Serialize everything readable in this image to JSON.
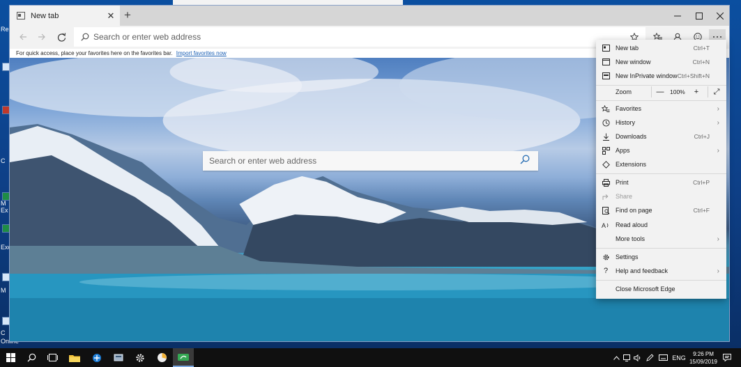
{
  "desktop": {
    "labels": [
      "Re",
      "C",
      "M",
      "Ex",
      "Exc",
      "M",
      "C",
      "Online"
    ]
  },
  "browser": {
    "tab_title": "New tab",
    "tab_close": "✕",
    "new_tab": "+",
    "address_placeholder": "Search or enter web address",
    "favorites_bar_text": "For quick access, place your favorites here on the favorites bar.",
    "favorites_bar_link": "Import favorites now",
    "page_search_placeholder": "Search or enter web address"
  },
  "menu": {
    "new_tab": {
      "label": "New tab",
      "shortcut": "Ctrl+T"
    },
    "new_window": {
      "label": "New window",
      "shortcut": "Ctrl+N"
    },
    "new_inprivate": {
      "label": "New InPrivate window",
      "shortcut": "Ctrl+Shift+N"
    },
    "zoom": {
      "label": "Zoom",
      "minus": "—",
      "value": "100%",
      "plus": "+",
      "fullscreen": "⤢"
    },
    "favorites": {
      "label": "Favorites"
    },
    "history": {
      "label": "History"
    },
    "downloads": {
      "label": "Downloads",
      "shortcut": "Ctrl+J"
    },
    "apps": {
      "label": "Apps"
    },
    "extensions": {
      "label": "Extensions"
    },
    "print": {
      "label": "Print",
      "shortcut": "Ctrl+P"
    },
    "share": {
      "label": "Share"
    },
    "find_on_page": {
      "label": "Find on page",
      "shortcut": "Ctrl+F"
    },
    "read_aloud": {
      "label": "Read aloud"
    },
    "more_tools": {
      "label": "More tools"
    },
    "settings": {
      "label": "Settings"
    },
    "help": {
      "label": "Help and feedback"
    },
    "close_edge": {
      "label": "Close Microsoft Edge"
    }
  },
  "taskbar": {
    "language": "ENG",
    "time": "9:26 PM",
    "date": "15/09/2019"
  },
  "icons": {
    "chevron": "›"
  }
}
